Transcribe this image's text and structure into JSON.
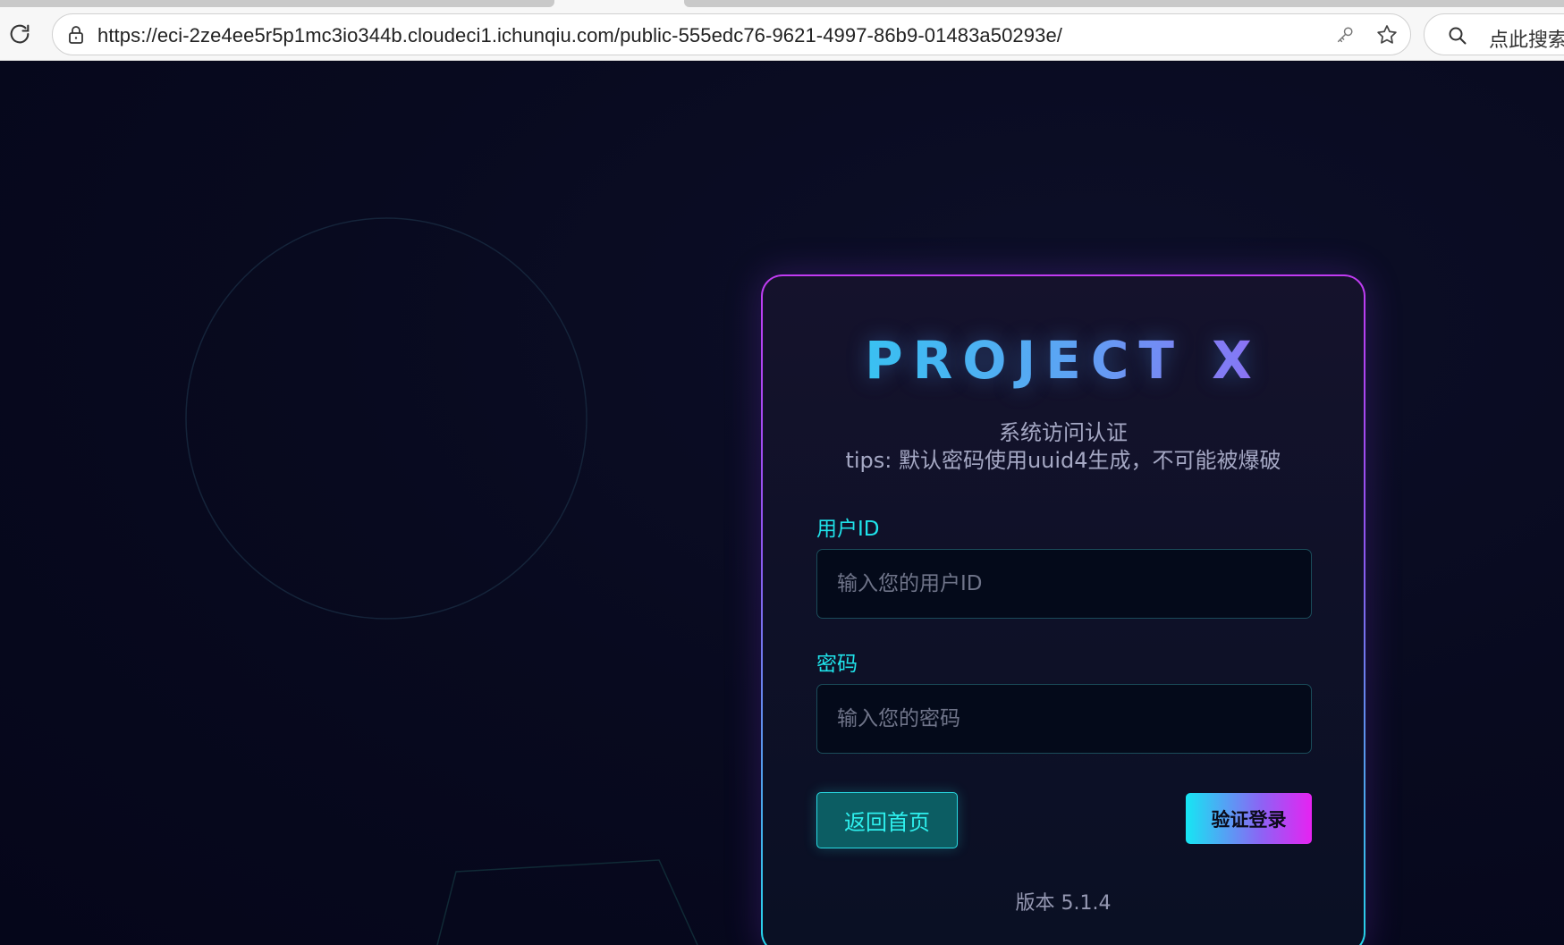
{
  "browser": {
    "url": "https://eci-2ze4ee5r5p1mc3io344b.cloudeci1.ichunqiu.com/public-555edc76-9621-4997-86b9-01483a50293e/",
    "search_placeholder": "点此搜索",
    "icons": [
      "reload-icon",
      "lock-icon",
      "key-icon",
      "star-icon",
      "search-icon"
    ]
  },
  "login": {
    "title": "PROJECT X",
    "subtitle_line1": "系统访问认证",
    "subtitle_line2": "tips: 默认密码使用uuid4生成，不可能被爆破",
    "user_label": "用户ID",
    "user_placeholder": "输入您的用户ID",
    "user_value": "",
    "password_label": "密码",
    "password_placeholder": "输入您的密码",
    "password_value": "",
    "back_button": "返回首页",
    "login_button": "验证登录",
    "version": "版本 5.1.4"
  },
  "colors": {
    "accent_cyan": "#1fe3ea",
    "accent_purple": "#b04ef4",
    "accent_magenta": "#e623f2",
    "background": "#07081a"
  }
}
